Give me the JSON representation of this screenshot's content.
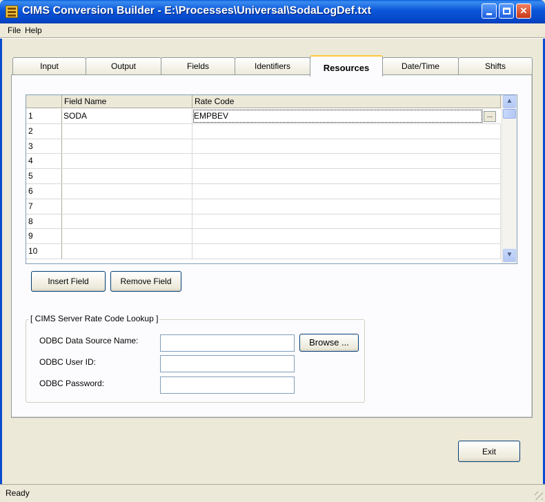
{
  "window": {
    "title": "CIMS Conversion Builder  - E:\\Processes\\Universal\\SodaLogDef.txt",
    "icon": "app-grid-icon"
  },
  "menu": [
    "File",
    "Help"
  ],
  "tabs": [
    {
      "label": "Input",
      "active": false
    },
    {
      "label": "Output",
      "active": false
    },
    {
      "label": "Fields",
      "active": false
    },
    {
      "label": "Identifiers",
      "active": false
    },
    {
      "label": "Resources",
      "active": true
    },
    {
      "label": "Date/Time",
      "active": false
    },
    {
      "label": "Shifts",
      "active": false
    }
  ],
  "grid": {
    "columns": [
      "Field Name",
      "Rate Code"
    ],
    "rows": [
      {
        "num": "1",
        "field_name": "SODA",
        "rate_code": "EMPBEV"
      },
      {
        "num": "2",
        "field_name": "",
        "rate_code": ""
      },
      {
        "num": "3",
        "field_name": "",
        "rate_code": ""
      },
      {
        "num": "4",
        "field_name": "",
        "rate_code": ""
      },
      {
        "num": "5",
        "field_name": "",
        "rate_code": ""
      },
      {
        "num": "6",
        "field_name": "",
        "rate_code": ""
      },
      {
        "num": "7",
        "field_name": "",
        "rate_code": ""
      },
      {
        "num": "8",
        "field_name": "",
        "rate_code": ""
      },
      {
        "num": "9",
        "field_name": "",
        "rate_code": ""
      },
      {
        "num": "10",
        "field_name": "",
        "rate_code": ""
      }
    ],
    "ellipsis_label": "..."
  },
  "buttons": {
    "insert_field": "Insert Field",
    "remove_field": "Remove Field",
    "browse": "Browse ...",
    "exit": "Exit"
  },
  "lookup": {
    "title": "[ CIMS Server Rate Code Lookup ]",
    "dsn_label": "ODBC Data Source Name:",
    "dsn_value": "",
    "user_label": "ODBC User ID:",
    "user_value": "",
    "password_label": "ODBC Password:",
    "password_value": ""
  },
  "status": "Ready"
}
